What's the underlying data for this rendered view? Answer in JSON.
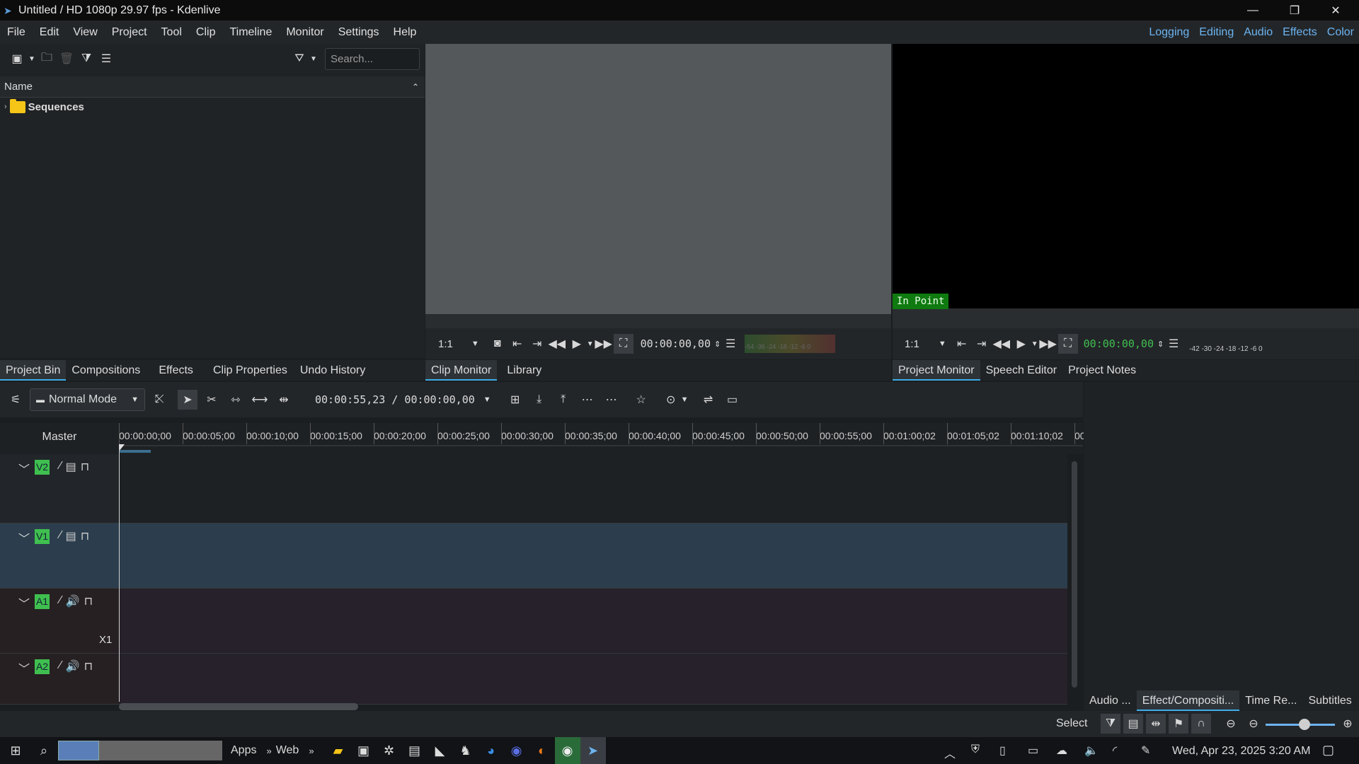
{
  "window": {
    "title": "Untitled / HD 1080p 29.97 fps - Kdenlive"
  },
  "menu": [
    "File",
    "Edit",
    "View",
    "Project",
    "Tool",
    "Clip",
    "Timeline",
    "Monitor",
    "Settings",
    "Help"
  ],
  "layouts": [
    "Logging",
    "Editing",
    "Audio",
    "Effects",
    "Color"
  ],
  "bin": {
    "search_placeholder": "Search...",
    "column_name": "Name",
    "folder": "Sequences"
  },
  "left_tabs": [
    "Project Bin",
    "Compositions",
    "Effects",
    "Clip Properties",
    "Undo History"
  ],
  "clip_monitor": {
    "zoom": "1:1",
    "timecode": "00:00:00,00",
    "tabs": [
      "Clip Monitor",
      "Library"
    ],
    "meter_labels": "-54 -36  -24 -18 -12 -6  0"
  },
  "project_monitor": {
    "zoom": "1:1",
    "timecode": "00:00:00,00",
    "in_point": "In Point",
    "tabs": [
      "Project Monitor",
      "Speech Editor",
      "Project Notes"
    ],
    "meter_labels": "-42  -30 -24  -18  -12   -6   0"
  },
  "timeline": {
    "mode": "Normal Mode",
    "position": "00:00:55,23 / 00:00:00,00",
    "master": "Master",
    "ruler": [
      "00:00:00;00",
      "00:00:05;00",
      "00:00:10;00",
      "00:00:15;00",
      "00:00:20;00",
      "00:00:25;00",
      "00:00:30;00",
      "00:00:35;00",
      "00:00:40;00",
      "00:00:45;00",
      "00:00:50;00",
      "00:00:55;00",
      "00:01:00;02",
      "00:01:05;02",
      "00:01:10;02",
      "00"
    ],
    "tracks": [
      {
        "tag": "V2",
        "type": "video"
      },
      {
        "tag": "V1",
        "type": "video"
      },
      {
        "tag": "A1",
        "type": "audio",
        "extra": "X1"
      },
      {
        "tag": "A2",
        "type": "audio"
      }
    ]
  },
  "right_tabs": [
    "Audio ...",
    "Effect/Compositi...",
    "Time Re...",
    "Subtitles"
  ],
  "status": {
    "mode": "Select"
  },
  "taskbar": {
    "apps_label": "Apps",
    "web_label": "Web",
    "datetime": "Wed, Apr 23, 2025  3:20 AM"
  }
}
